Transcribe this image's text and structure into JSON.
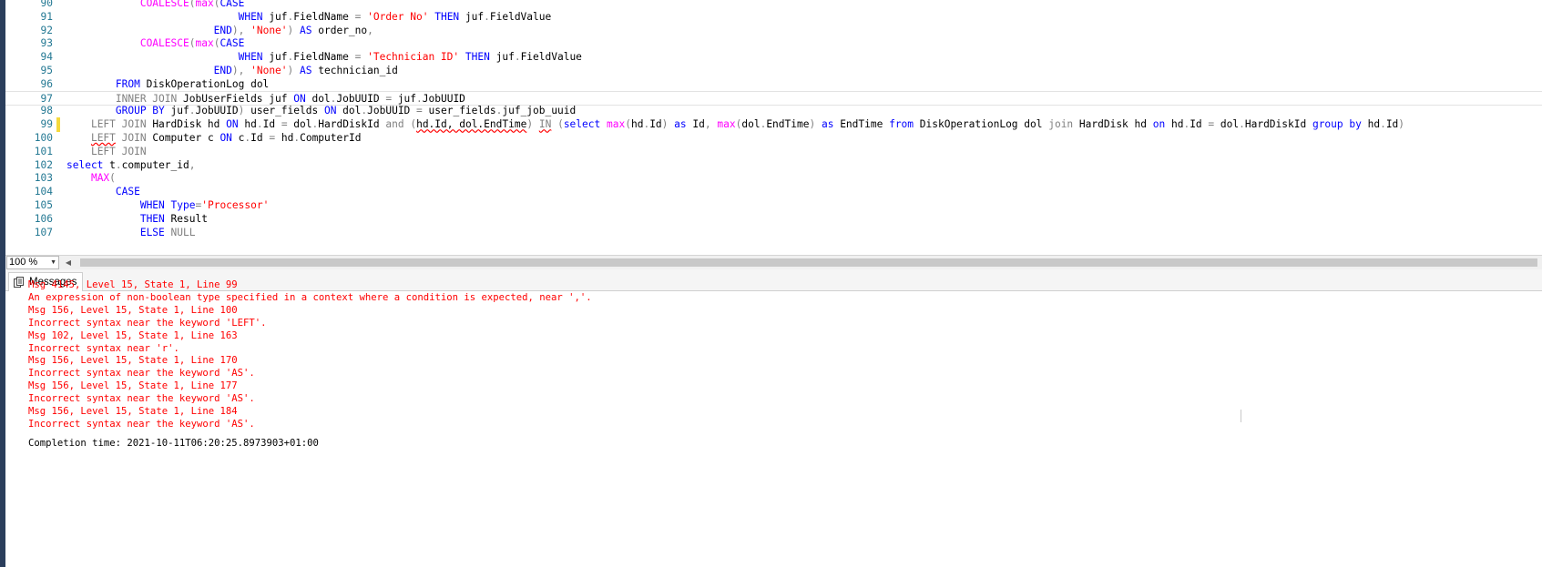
{
  "editor": {
    "current_line": "97",
    "lines": [
      {
        "n": "90",
        "tokens": [
          {
            "t": "            ",
            "c": ""
          },
          {
            "t": "COALESCE",
            "c": "fn"
          },
          {
            "t": "(",
            "c": "op"
          },
          {
            "t": "max",
            "c": "fn"
          },
          {
            "t": "(",
            "c": "op"
          },
          {
            "t": "CASE",
            "c": "kw"
          }
        ]
      },
      {
        "n": "91",
        "tokens": [
          {
            "t": "                            ",
            "c": ""
          },
          {
            "t": "WHEN",
            "c": "kw"
          },
          {
            "t": " juf",
            "c": ""
          },
          {
            "t": ".",
            "c": "op"
          },
          {
            "t": "FieldName ",
            "c": ""
          },
          {
            "t": "=",
            "c": "op"
          },
          {
            "t": " ",
            "c": ""
          },
          {
            "t": "'Order No'",
            "c": "str"
          },
          {
            "t": " ",
            "c": ""
          },
          {
            "t": "THEN",
            "c": "kw"
          },
          {
            "t": " juf",
            "c": ""
          },
          {
            "t": ".",
            "c": "op"
          },
          {
            "t": "FieldValue",
            "c": ""
          }
        ]
      },
      {
        "n": "92",
        "tokens": [
          {
            "t": "                        ",
            "c": ""
          },
          {
            "t": "END",
            "c": "kw"
          },
          {
            "t": "),",
            "c": "op"
          },
          {
            "t": " ",
            "c": ""
          },
          {
            "t": "'None'",
            "c": "str"
          },
          {
            "t": ")",
            "c": "op"
          },
          {
            "t": " ",
            "c": ""
          },
          {
            "t": "AS",
            "c": "kw"
          },
          {
            "t": " order_no",
            "c": ""
          },
          {
            "t": ",",
            "c": "op"
          }
        ]
      },
      {
        "n": "93",
        "tokens": [
          {
            "t": "            ",
            "c": ""
          },
          {
            "t": "COALESCE",
            "c": "fn"
          },
          {
            "t": "(",
            "c": "op"
          },
          {
            "t": "max",
            "c": "fn"
          },
          {
            "t": "(",
            "c": "op"
          },
          {
            "t": "CASE",
            "c": "kw"
          }
        ]
      },
      {
        "n": "94",
        "tokens": [
          {
            "t": "                            ",
            "c": ""
          },
          {
            "t": "WHEN",
            "c": "kw"
          },
          {
            "t": " juf",
            "c": ""
          },
          {
            "t": ".",
            "c": "op"
          },
          {
            "t": "FieldName ",
            "c": ""
          },
          {
            "t": "=",
            "c": "op"
          },
          {
            "t": " ",
            "c": ""
          },
          {
            "t": "'Technician ID'",
            "c": "str"
          },
          {
            "t": " ",
            "c": ""
          },
          {
            "t": "THEN",
            "c": "kw"
          },
          {
            "t": " juf",
            "c": ""
          },
          {
            "t": ".",
            "c": "op"
          },
          {
            "t": "FieldValue",
            "c": ""
          }
        ]
      },
      {
        "n": "95",
        "tokens": [
          {
            "t": "                        ",
            "c": ""
          },
          {
            "t": "END",
            "c": "kw"
          },
          {
            "t": "),",
            "c": "op"
          },
          {
            "t": " ",
            "c": ""
          },
          {
            "t": "'None'",
            "c": "str"
          },
          {
            "t": ")",
            "c": "op"
          },
          {
            "t": " ",
            "c": ""
          },
          {
            "t": "AS",
            "c": "kw"
          },
          {
            "t": " technician_id",
            "c": ""
          }
        ]
      },
      {
        "n": "96",
        "tokens": [
          {
            "t": "        ",
            "c": ""
          },
          {
            "t": "FROM",
            "c": "kw"
          },
          {
            "t": " DiskOperationLog dol",
            "c": ""
          }
        ]
      },
      {
        "n": "97",
        "tokens": [
          {
            "t": "        ",
            "c": ""
          },
          {
            "t": "INNER JOIN",
            "c": "op"
          },
          {
            "t": " JobUserFields juf ",
            "c": ""
          },
          {
            "t": "ON",
            "c": "kw"
          },
          {
            "t": " dol",
            "c": ""
          },
          {
            "t": ".",
            "c": "op"
          },
          {
            "t": "JobUUID ",
            "c": ""
          },
          {
            "t": "=",
            "c": "op"
          },
          {
            "t": " juf",
            "c": ""
          },
          {
            "t": ".",
            "c": "op"
          },
          {
            "t": "JobUUID",
            "c": ""
          }
        ]
      },
      {
        "n": "98",
        "tokens": [
          {
            "t": "        ",
            "c": ""
          },
          {
            "t": "GROUP BY",
            "c": "kw"
          },
          {
            "t": " juf",
            "c": ""
          },
          {
            "t": ".",
            "c": "op"
          },
          {
            "t": "JobUUID",
            "c": ""
          },
          {
            "t": ")",
            "c": "op"
          },
          {
            "t": " user_fields ",
            "c": ""
          },
          {
            "t": "ON",
            "c": "kw"
          },
          {
            "t": " dol",
            "c": ""
          },
          {
            "t": ".",
            "c": "op"
          },
          {
            "t": "JobUUID ",
            "c": ""
          },
          {
            "t": "=",
            "c": "op"
          },
          {
            "t": " user_fields",
            "c": ""
          },
          {
            "t": ".",
            "c": "op"
          },
          {
            "t": "juf_job_uuid",
            "c": ""
          }
        ]
      },
      {
        "n": "99",
        "changed": true,
        "tokens": [
          {
            "t": "    ",
            "c": ""
          },
          {
            "t": "LEFT JOIN",
            "c": "op"
          },
          {
            "t": " HardDisk hd ",
            "c": ""
          },
          {
            "t": "ON",
            "c": "kw"
          },
          {
            "t": " hd",
            "c": ""
          },
          {
            "t": ".",
            "c": "op"
          },
          {
            "t": "Id ",
            "c": ""
          },
          {
            "t": "=",
            "c": "op"
          },
          {
            "t": " dol",
            "c": ""
          },
          {
            "t": ".",
            "c": "op"
          },
          {
            "t": "HardDiskId ",
            "c": ""
          },
          {
            "t": "and",
            "c": "op"
          },
          {
            "t": " ",
            "c": ""
          },
          {
            "t": "(",
            "c": "op"
          },
          {
            "t": "hd.Id, dol.EndTime",
            "c": "err"
          },
          {
            "t": ")",
            "c": "op"
          },
          {
            "t": " ",
            "c": ""
          },
          {
            "t": "IN",
            "c": "op err"
          },
          {
            "t": " ",
            "c": ""
          },
          {
            "t": "(",
            "c": "op"
          },
          {
            "t": "select",
            "c": "kw"
          },
          {
            "t": " ",
            "c": ""
          },
          {
            "t": "max",
            "c": "fn"
          },
          {
            "t": "(",
            "c": "op"
          },
          {
            "t": "hd",
            "c": ""
          },
          {
            "t": ".",
            "c": "op"
          },
          {
            "t": "Id",
            "c": ""
          },
          {
            "t": ")",
            "c": "op"
          },
          {
            "t": " ",
            "c": ""
          },
          {
            "t": "as",
            "c": "kw"
          },
          {
            "t": " Id",
            "c": ""
          },
          {
            "t": ",",
            "c": "op"
          },
          {
            "t": " ",
            "c": ""
          },
          {
            "t": "max",
            "c": "fn"
          },
          {
            "t": "(",
            "c": "op"
          },
          {
            "t": "dol",
            "c": ""
          },
          {
            "t": ".",
            "c": "op"
          },
          {
            "t": "EndTime",
            "c": ""
          },
          {
            "t": ")",
            "c": "op"
          },
          {
            "t": " ",
            "c": ""
          },
          {
            "t": "as",
            "c": "kw"
          },
          {
            "t": " EndTime ",
            "c": ""
          },
          {
            "t": "from",
            "c": "kw"
          },
          {
            "t": " DiskOperationLog dol ",
            "c": ""
          },
          {
            "t": "join",
            "c": "op"
          },
          {
            "t": " HardDisk hd ",
            "c": ""
          },
          {
            "t": "on",
            "c": "kw"
          },
          {
            "t": " hd",
            "c": ""
          },
          {
            "t": ".",
            "c": "op"
          },
          {
            "t": "Id ",
            "c": ""
          },
          {
            "t": "=",
            "c": "op"
          },
          {
            "t": " dol",
            "c": ""
          },
          {
            "t": ".",
            "c": "op"
          },
          {
            "t": "HardDiskId ",
            "c": ""
          },
          {
            "t": "group by",
            "c": "kw"
          },
          {
            "t": " hd",
            "c": ""
          },
          {
            "t": ".",
            "c": "op"
          },
          {
            "t": "Id",
            "c": ""
          },
          {
            "t": ")",
            "c": "op"
          }
        ]
      },
      {
        "n": "100",
        "tokens": [
          {
            "t": "    ",
            "c": ""
          },
          {
            "t": "LEFT",
            "c": "op err"
          },
          {
            "t": " ",
            "c": ""
          },
          {
            "t": "JOIN",
            "c": "op"
          },
          {
            "t": " Computer c ",
            "c": ""
          },
          {
            "t": "ON",
            "c": "kw"
          },
          {
            "t": " c",
            "c": ""
          },
          {
            "t": ".",
            "c": "op"
          },
          {
            "t": "Id ",
            "c": ""
          },
          {
            "t": "=",
            "c": "op"
          },
          {
            "t": " hd",
            "c": ""
          },
          {
            "t": ".",
            "c": "op"
          },
          {
            "t": "ComputerId",
            "c": ""
          }
        ]
      },
      {
        "n": "101",
        "tokens": [
          {
            "t": "    ",
            "c": ""
          },
          {
            "t": "LEFT JOIN",
            "c": "op"
          }
        ]
      },
      {
        "n": "102",
        "tokens": [
          {
            "t": "select",
            "c": "kw"
          },
          {
            "t": " t",
            "c": ""
          },
          {
            "t": ".",
            "c": "op"
          },
          {
            "t": "computer_id",
            "c": ""
          },
          {
            "t": ",",
            "c": "op"
          }
        ]
      },
      {
        "n": "103",
        "tokens": [
          {
            "t": "    ",
            "c": ""
          },
          {
            "t": "MAX",
            "c": "fn"
          },
          {
            "t": "(",
            "c": "op"
          }
        ]
      },
      {
        "n": "104",
        "tokens": [
          {
            "t": "        ",
            "c": ""
          },
          {
            "t": "CASE",
            "c": "kw"
          }
        ]
      },
      {
        "n": "105",
        "tokens": [
          {
            "t": "            ",
            "c": ""
          },
          {
            "t": "WHEN",
            "c": "kw"
          },
          {
            "t": " ",
            "c": ""
          },
          {
            "t": "Type",
            "c": "kw"
          },
          {
            "t": "=",
            "c": "op"
          },
          {
            "t": "'Processor'",
            "c": "str"
          }
        ]
      },
      {
        "n": "106",
        "tokens": [
          {
            "t": "            ",
            "c": ""
          },
          {
            "t": "THEN",
            "c": "kw"
          },
          {
            "t": " Result",
            "c": ""
          }
        ]
      },
      {
        "n": "107",
        "tokens": [
          {
            "t": "            ",
            "c": ""
          },
          {
            "t": "ELSE",
            "c": "kw"
          },
          {
            "t": " ",
            "c": ""
          },
          {
            "t": "NULL",
            "c": "op"
          }
        ]
      }
    ]
  },
  "zoom": {
    "value": "100 %"
  },
  "results": {
    "tab_label": "Messages",
    "messages": [
      "Msg 4145, Level 15, State 1, Line 99",
      "An expression of non-boolean type specified in a context where a condition is expected, near ','.",
      "Msg 156, Level 15, State 1, Line 100",
      "Incorrect syntax near the keyword 'LEFT'.",
      "Msg 102, Level 15, State 1, Line 163",
      "Incorrect syntax near 'r'.",
      "Msg 156, Level 15, State 1, Line 170",
      "Incorrect syntax near the keyword 'AS'.",
      "Msg 156, Level 15, State 1, Line 177",
      "Incorrect syntax near the keyword 'AS'.",
      "Msg 156, Level 15, State 1, Line 184",
      "Incorrect syntax near the keyword 'AS'."
    ],
    "completion": "Completion time: 2021-10-11T06:20:25.8973903+01:00"
  },
  "colors": {
    "keyword": "#0000ff",
    "function": "#ff00ff",
    "string": "#ff0000",
    "operator": "#808080",
    "line_number": "#237893",
    "error_text": "#ff0000",
    "change_marker": "#f5d93c"
  }
}
